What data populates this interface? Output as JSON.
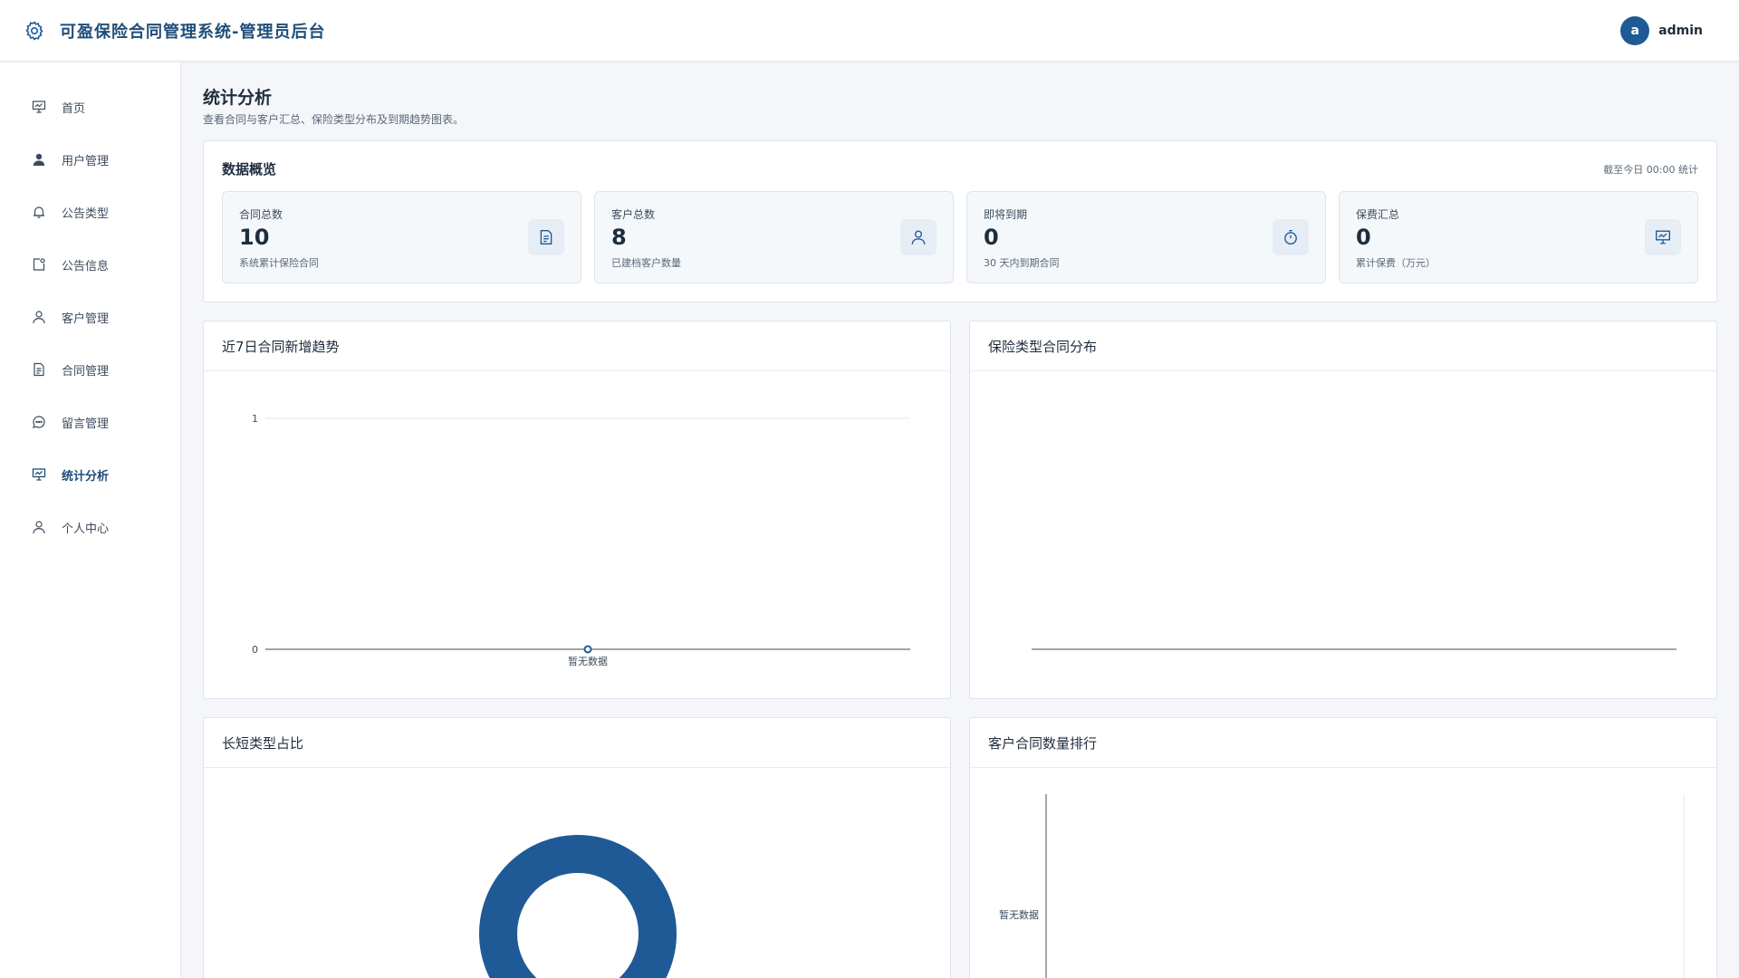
{
  "header": {
    "title": "可盈保险合同管理系统-管理员后台",
    "avatar_letter": "a",
    "username": "admin",
    "logo_icon": "gear-icon"
  },
  "sidebar": {
    "items": [
      {
        "label": "首页",
        "icon": "presentation-icon",
        "active": false
      },
      {
        "label": "用户管理",
        "icon": "user-filled-icon",
        "active": false
      },
      {
        "label": "公告类型",
        "icon": "bell-icon",
        "active": false
      },
      {
        "label": "公告信息",
        "icon": "note-icon",
        "active": false
      },
      {
        "label": "客户管理",
        "icon": "user-icon",
        "active": false
      },
      {
        "label": "合同管理",
        "icon": "document-icon",
        "active": false
      },
      {
        "label": "留言管理",
        "icon": "chat-icon",
        "active": false
      },
      {
        "label": "统计分析",
        "icon": "presentation-icon",
        "active": true
      },
      {
        "label": "个人中心",
        "icon": "user-icon",
        "active": false
      }
    ]
  },
  "page": {
    "title": "统计分析",
    "subtitle": "查看合同与客户汇总、保险类型分布及到期趋势图表。"
  },
  "overview": {
    "title": "数据概览",
    "note": "截至今日 00:00 统计",
    "stats": [
      {
        "label": "合同总数",
        "value": "10",
        "desc": "系统累计保险合同",
        "icon": "document-icon"
      },
      {
        "label": "客户总数",
        "value": "8",
        "desc": "已建档客户数量",
        "icon": "user-icon"
      },
      {
        "label": "即将到期",
        "value": "0",
        "desc": "30 天内到期合同",
        "icon": "stopwatch-icon"
      },
      {
        "label": "保费汇总",
        "value": "0",
        "desc": "累计保费（万元）",
        "icon": "presentation-icon"
      }
    ]
  },
  "cards": {
    "trend": "近7日合同新增趋势",
    "type_dist": "保险类型合同分布",
    "long_short": "长短类型占比",
    "ranking": "客户合同数量排行"
  },
  "colors": {
    "primary": "#1f5a96",
    "accent_text": "#1f4e79"
  },
  "chart_data": [
    {
      "type": "line",
      "title": "近7日合同新增趋势",
      "categories": [
        "暂无数据"
      ],
      "series": [
        {
          "values": [
            0
          ]
        }
      ],
      "ylim": [
        0,
        1
      ],
      "yticks": [
        "0",
        "1"
      ],
      "grid": true
    },
    {
      "type": "bar",
      "title": "保险类型合同分布",
      "categories": [],
      "series": []
    },
    {
      "type": "pie",
      "title": "长短类型占比",
      "donut": true,
      "slices": [
        {
          "value": 1,
          "color": "#1f5a96"
        }
      ]
    },
    {
      "type": "bar",
      "title": "客户合同数量排行",
      "orientation": "horizontal",
      "categories": [
        "暂无数据"
      ],
      "series": [
        {
          "values": [
            0
          ]
        }
      ]
    }
  ]
}
